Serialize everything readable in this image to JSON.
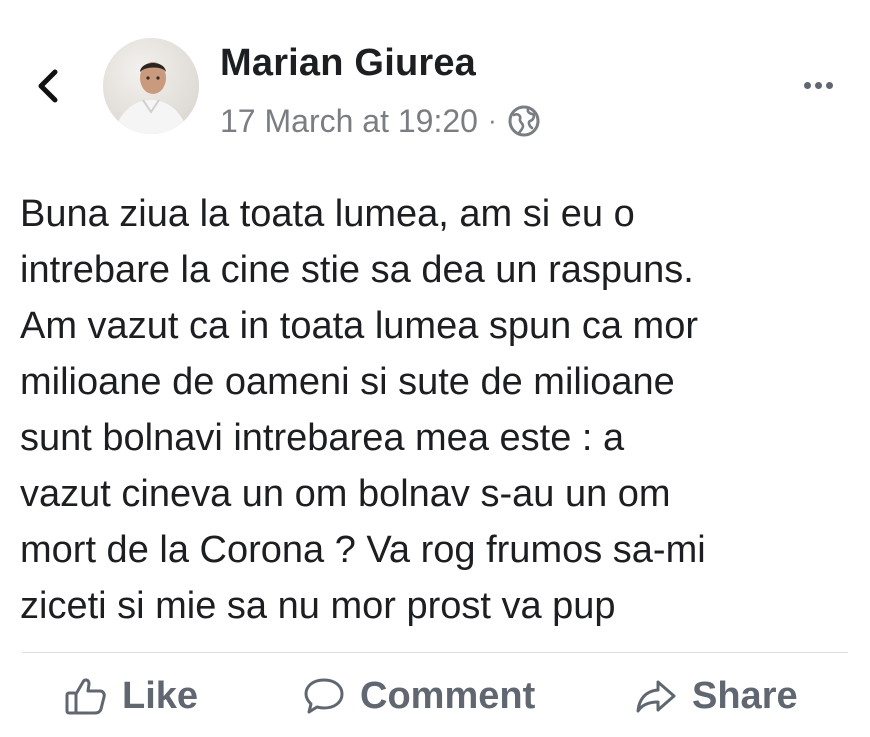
{
  "post": {
    "author": "Marian Giurea",
    "timestamp": "17 March at 19:20",
    "separator": "·",
    "privacy_icon": "globe-icon",
    "text": "Buna ziua la toata lumea, am si eu o\nintrebare la cine stie sa dea un raspuns.\nAm vazut ca in toata lumea spun ca mor\nmilioane de oameni si sute de milioane\nsunt bolnavi intrebarea mea este : a\nvazut cineva un om bolnav s-au un om\nmort de la Corona ? Va rog frumos sa-mi\nziceti si mie sa nu mor prost va pup"
  },
  "actions": {
    "like_label": "Like",
    "comment_label": "Comment",
    "share_label": "Share"
  },
  "icons": {
    "back": "chevron-left-icon",
    "more": "more-horizontal-icon",
    "like": "thumbs-up-icon",
    "comment": "speech-bubble-icon",
    "share": "share-arrow-icon"
  },
  "colors": {
    "text": "#1c1e21",
    "secondary_text": "#7a7d82",
    "action_text": "#606770",
    "divider": "#dadde1"
  }
}
